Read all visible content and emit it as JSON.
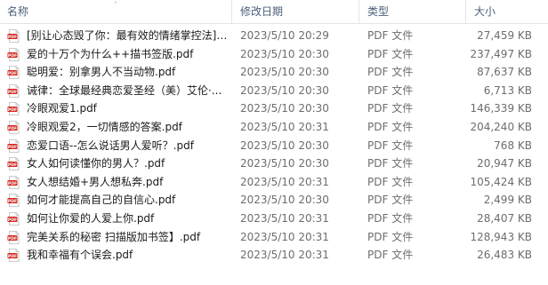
{
  "columns": {
    "name": "名称",
    "date": "修改日期",
    "type": "类型",
    "size": "大小"
  },
  "icon": {
    "name": "pdf-file-icon",
    "label": "PDF",
    "color": "#d0251c"
  },
  "files": [
    {
      "name": "[别让心态毁了你：最有效的情绪掌控法]....",
      "date": "2023/5/10 20:29",
      "type": "PDF 文件",
      "size": "27,459 KB"
    },
    {
      "name": "爱的十万个为什么++描书签版.pdf",
      "date": "2023/5/10 20:30",
      "type": "PDF 文件",
      "size": "237,497 KB"
    },
    {
      "name": "聪明爱：别拿男人不当动物.pdf",
      "date": "2023/5/10 20:30",
      "type": "PDF 文件",
      "size": "87,637 KB"
    },
    {
      "name": "诫律：全球最经典恋爱圣经（美）艾伦·...",
      "date": "2023/5/10 20:30",
      "type": "PDF 文件",
      "size": "6,713 KB"
    },
    {
      "name": "冷眼观爱1.pdf",
      "date": "2023/5/10 20:30",
      "type": "PDF 文件",
      "size": "146,339 KB"
    },
    {
      "name": "冷眼观爱2，一切情感的答案.pdf",
      "date": "2023/5/10 20:31",
      "type": "PDF 文件",
      "size": "204,240 KB"
    },
    {
      "name": "恋爱口语--怎么说话男人爱听？.pdf",
      "date": "2023/5/10 20:30",
      "type": "PDF 文件",
      "size": "768 KB"
    },
    {
      "name": "女人如何读懂你的男人？.pdf",
      "date": "2023/5/10 20:30",
      "type": "PDF 文件",
      "size": "20,947 KB"
    },
    {
      "name": "女人想结婚+男人想私奔.pdf",
      "date": "2023/5/10 20:31",
      "type": "PDF 文件",
      "size": "105,424 KB"
    },
    {
      "name": "如何才能提高自己的自信心.pdf",
      "date": "2023/5/10 20:30",
      "type": "PDF 文件",
      "size": "2,499 KB"
    },
    {
      "name": "如何让你爱的人爱上你.pdf",
      "date": "2023/5/10 20:31",
      "type": "PDF 文件",
      "size": "28,407 KB"
    },
    {
      "name": "完美关系的秘密 扫描版加书签】.pdf",
      "date": "2023/5/10 20:31",
      "type": "PDF 文件",
      "size": "128,943 KB"
    },
    {
      "name": "我和幸福有个误会.pdf",
      "date": "2023/5/10 20:31",
      "type": "PDF 文件",
      "size": "26,483 KB"
    }
  ]
}
